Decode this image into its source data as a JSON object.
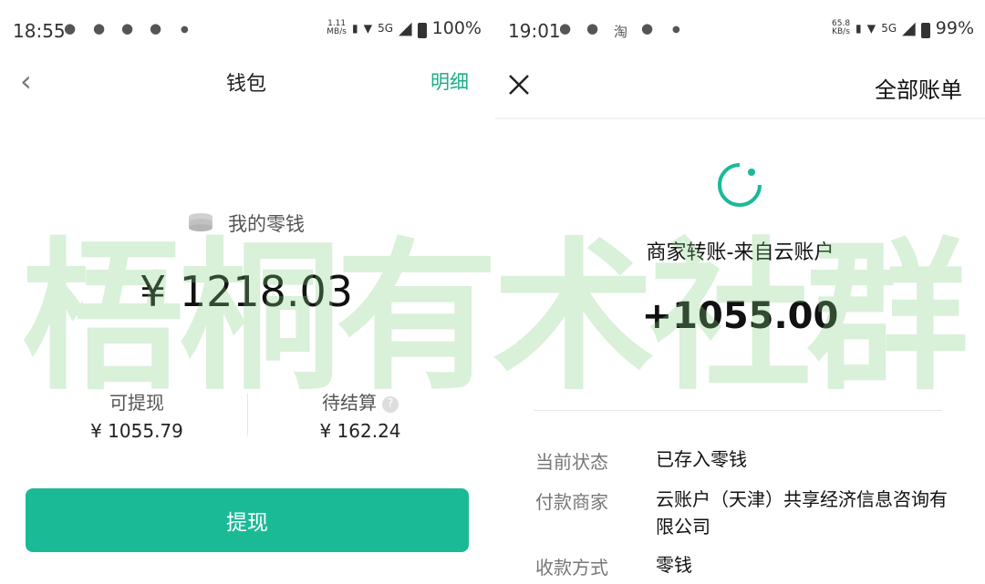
{
  "left": {
    "status": {
      "time": "18:55",
      "speed_value": "1.11",
      "speed_unit": "MB/s",
      "network": "5G",
      "battery": "100%"
    },
    "header": {
      "title": "钱包",
      "detail_link": "明细"
    },
    "wallet": {
      "label": "我的零钱",
      "balance": "¥ 1218.03"
    },
    "withdrawable": {
      "label": "可提现",
      "value": "¥ 1055.79"
    },
    "pending": {
      "label": "待结算",
      "help": "?",
      "value": "¥ 162.24"
    },
    "withdraw_button": "提现"
  },
  "right": {
    "status": {
      "time": "19:01",
      "app_badge": "淘",
      "speed_value": "65.8",
      "speed_unit": "KB/s",
      "network": "5G",
      "battery": "99%"
    },
    "header": {
      "all_bills": "全部账单"
    },
    "transaction": {
      "title": "商家转账-来自云账户",
      "amount": "+1055.00"
    },
    "details": [
      {
        "label": "当前状态",
        "value": "已存入零钱"
      },
      {
        "label": "付款商家",
        "value": "云账户（天津）共享经济信息咨询有限公司"
      },
      {
        "label": "收款方式",
        "value": "零钱"
      }
    ]
  },
  "watermark": "梧桐有术社群",
  "icons": {
    "left_status_apps": [
      "wechat-icon",
      "qq-icon",
      "wechat-icon",
      "hand-icon"
    ],
    "right_status_apps": [
      "wechat-icon",
      "wechat-icon",
      "taobao-icon",
      "qq-icon"
    ],
    "back": "chevron-left-icon",
    "close": "close-icon",
    "coin": "coin-stack-icon",
    "spinner": "processing-icon"
  },
  "colors": {
    "accent": "#1aba97",
    "link": "#1bae8a",
    "watermark": "#82cd82"
  }
}
